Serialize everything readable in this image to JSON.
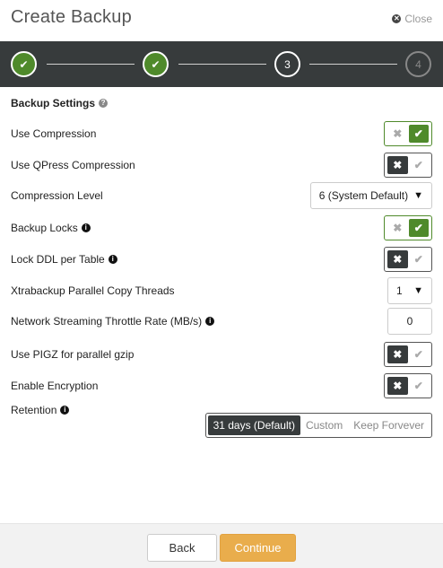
{
  "dialog": {
    "title": "Create Backup",
    "close_label": "Close"
  },
  "stepper": {
    "steps": [
      {
        "label": "",
        "state": "done"
      },
      {
        "label": "",
        "state": "done"
      },
      {
        "label": "3",
        "state": "active"
      },
      {
        "label": "4",
        "state": "todo"
      }
    ]
  },
  "section": {
    "title": "Backup Settings"
  },
  "settings": {
    "use_compression": {
      "label": "Use Compression",
      "value": "on"
    },
    "use_qpress": {
      "label": "Use QPress Compression",
      "value": "off"
    },
    "compression_level": {
      "label": "Compression Level",
      "value": "6 (System Default)"
    },
    "backup_locks": {
      "label": "Backup Locks",
      "value": "on"
    },
    "lock_ddl": {
      "label": "Lock DDL per Table",
      "value": "off"
    },
    "parallel_threads": {
      "label": "Xtrabackup Parallel Copy Threads",
      "value": "1"
    },
    "throttle_rate": {
      "label": "Network Streaming Throttle Rate (MB/s)",
      "value": "0"
    },
    "use_pigz": {
      "label": "Use PIGZ for parallel gzip",
      "value": "off"
    },
    "enable_encryption": {
      "label": "Enable Encryption",
      "value": "off"
    },
    "retention": {
      "label": "Retention",
      "options": [
        "31 days (Default)",
        "Custom",
        "Keep Forvever"
      ],
      "selected": "31 days (Default)"
    }
  },
  "footer": {
    "back_label": "Back",
    "continue_label": "Continue"
  },
  "colors": {
    "accent_green": "#4f8a2b",
    "dark": "#373b3c",
    "continue": "#e9ad4c"
  }
}
